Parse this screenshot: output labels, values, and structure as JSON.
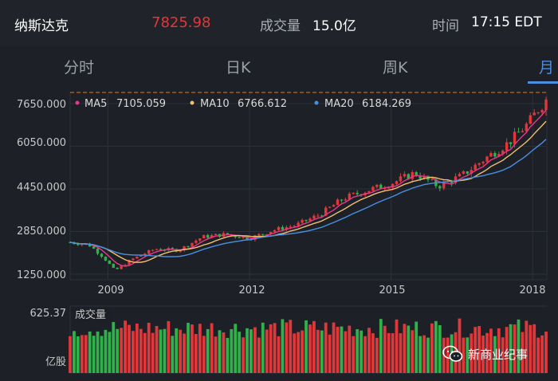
{
  "header": {
    "name": "纳斯达克",
    "price": "7825.98",
    "volume_label": "成交量",
    "volume_value": "15.0亿",
    "time_label": "时间",
    "time_value": "17:15 EDT"
  },
  "colors": {
    "up": "#e0383a",
    "down": "#2fb24a",
    "price": "#e0383a",
    "accent": "#4c8fe0",
    "ma5": "#e8378a",
    "ma10": "#f0c070",
    "ma20": "#4a90e2"
  },
  "tabs": [
    {
      "label": "分时",
      "active": false
    },
    {
      "label": "日K",
      "active": false
    },
    {
      "label": "周K",
      "active": false
    },
    {
      "label": "月",
      "active": true
    }
  ],
  "legend": [
    {
      "key": "MA5",
      "value": "7105.059",
      "color": "#e8378a"
    },
    {
      "key": "MA10",
      "value": "6766.612",
      "color": "#f0c070"
    },
    {
      "key": "MA20",
      "value": "6184.269",
      "color": "#4a90e2"
    }
  ],
  "watermark": {
    "text": "新商业纪事",
    "icon": "wechat-icon"
  },
  "chart_data": {
    "type": "candlestick",
    "y_ticks": [
      "7650.000",
      "6050.000",
      "4450.000",
      "2850.000",
      "1250.000"
    ],
    "y_tick_values": [
      7650,
      6050,
      4450,
      2850,
      1250
    ],
    "ylim": [
      1000,
      8100
    ],
    "x_ticks": [
      "2009",
      "2012",
      "2015",
      "2018"
    ],
    "x_tick_values": [
      2009,
      2012,
      2015,
      2018
    ],
    "xlim": [
      2008.2,
      2018.3
    ],
    "grid": true,
    "close_series": [
      {
        "t": 2008.2,
        "v": 2450
      },
      {
        "t": 2008.6,
        "v": 2350
      },
      {
        "t": 2008.9,
        "v": 1900
      },
      {
        "t": 2009.15,
        "v": 1380
      },
      {
        "t": 2009.5,
        "v": 1800
      },
      {
        "t": 2010.0,
        "v": 2200
      },
      {
        "t": 2010.5,
        "v": 2150
      },
      {
        "t": 2011.0,
        "v": 2650
      },
      {
        "t": 2011.5,
        "v": 2750
      },
      {
        "t": 2012.0,
        "v": 2600
      },
      {
        "t": 2012.5,
        "v": 2900
      },
      {
        "t": 2013.0,
        "v": 3100
      },
      {
        "t": 2013.5,
        "v": 3500
      },
      {
        "t": 2014.0,
        "v": 4100
      },
      {
        "t": 2014.5,
        "v": 4400
      },
      {
        "t": 2015.0,
        "v": 4650
      },
      {
        "t": 2015.5,
        "v": 5050
      },
      {
        "t": 2016.0,
        "v": 4550
      },
      {
        "t": 2016.5,
        "v": 4950
      },
      {
        "t": 2017.0,
        "v": 5600
      },
      {
        "t": 2017.5,
        "v": 6200
      },
      {
        "t": 2017.9,
        "v": 6900
      },
      {
        "t": 2018.1,
        "v": 7400
      },
      {
        "t": 2018.3,
        "v": 7825
      }
    ],
    "volume": {
      "label": "成交量",
      "max_label": "625.37",
      "unit_label": "亿股",
      "max": 625.37
    }
  }
}
